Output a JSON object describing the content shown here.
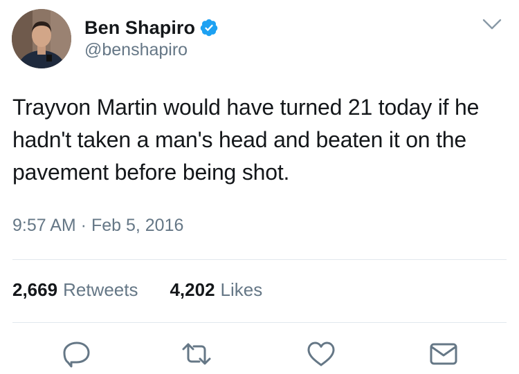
{
  "tweet": {
    "author": {
      "display_name": "Ben Shapiro",
      "handle": "@benshapiro",
      "verified": true
    },
    "text": "Trayvon Martin would have turned 21 today if he hadn't taken a man's head and beaten it on the pavement before being shot.",
    "timestamp": "9:57 AM · Feb 5, 2016",
    "stats": {
      "retweets_count": "2,669",
      "retweets_label": "Retweets",
      "likes_count": "4,202",
      "likes_label": "Likes"
    },
    "actions": {
      "reply_icon": "reply-icon",
      "retweet_icon": "retweet-icon",
      "like_icon": "heart-icon",
      "dm_icon": "envelope-icon"
    }
  },
  "colors": {
    "verified_blue": "#1da1f2",
    "text": "#14171a",
    "secondary": "#657786",
    "icon": "#657786",
    "divider": "#e1e8ed"
  }
}
